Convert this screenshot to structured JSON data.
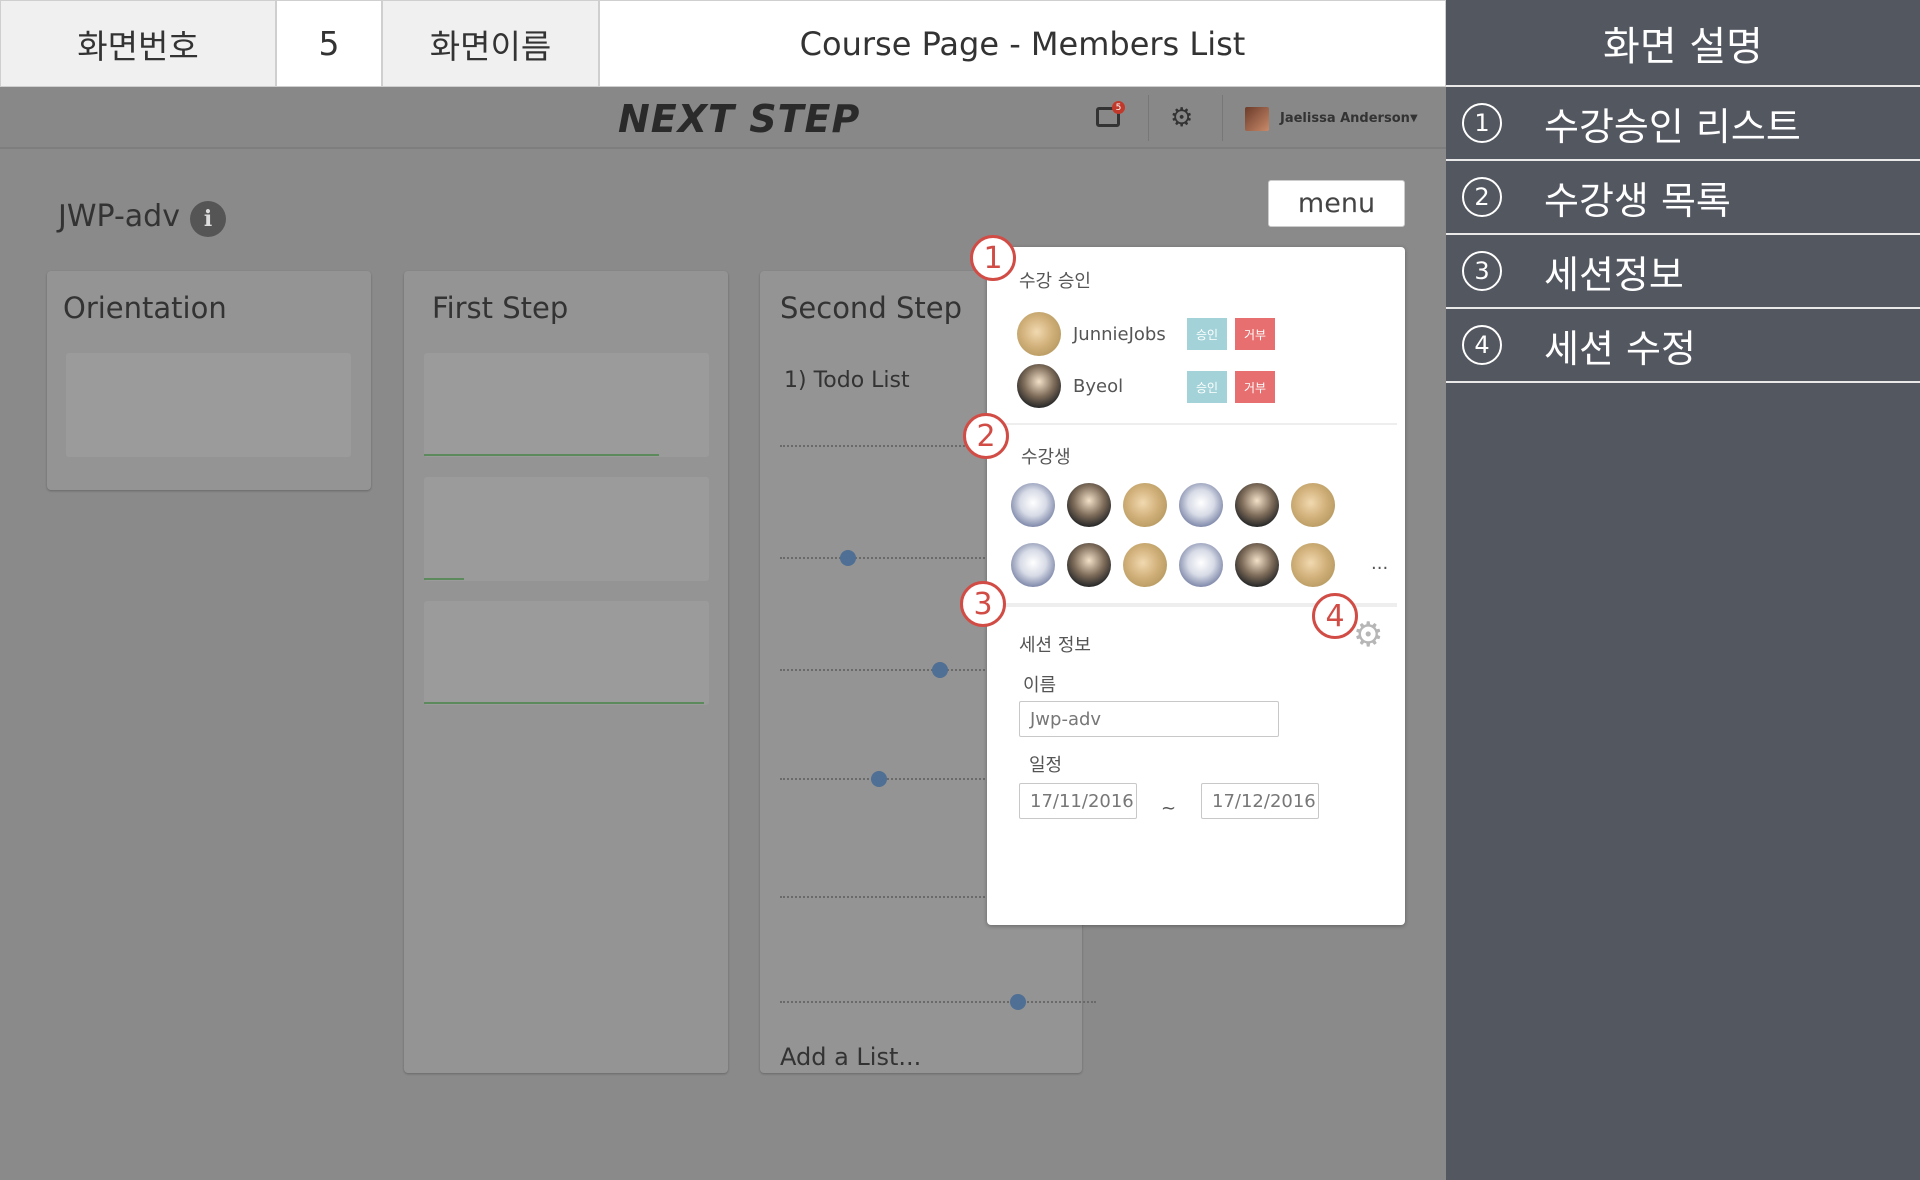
{
  "spec": {
    "screen_no_label": "화면번호",
    "screen_no": "5",
    "screen_name_label": "화면이름",
    "screen_name": "Course Page - Members List"
  },
  "description": {
    "title": "화면 설명",
    "items": [
      {
        "num": "1",
        "text": "수강승인 리스트"
      },
      {
        "num": "2",
        "text": "수강생 목록"
      },
      {
        "num": "3",
        "text": "세션정보"
      },
      {
        "num": "4",
        "text": "세션 수정"
      }
    ]
  },
  "topbar": {
    "logo": "NEXT STEP",
    "notification_count": "5",
    "user_name": "Jaelissa Anderson",
    "icons": [
      "notification-icon",
      "gear-icon",
      "caret-down-icon"
    ]
  },
  "board": {
    "title": "JWP-adv",
    "menu_label": "menu",
    "columns": [
      {
        "title": "Orientation"
      },
      {
        "title": "First Step"
      },
      {
        "title": "Second Step",
        "todo_title": "1) Todo List",
        "add_list": "Add a List..."
      }
    ]
  },
  "popup": {
    "approval_title": "수강 승인",
    "approvals": [
      {
        "name": "JunnieJobs",
        "approve": "승인",
        "reject": "거부"
      },
      {
        "name": "Byeol",
        "approve": "승인",
        "reject": "거부"
      }
    ],
    "members_title": "수강생",
    "members_more": "...",
    "session_title": "세션 정보",
    "name_label": "이름",
    "name_value": "Jwp-adv",
    "schedule_label": "일정",
    "start_date": "17/11/2016",
    "end_date": "17/12/2016",
    "date_separator": "~"
  },
  "markers": [
    "1",
    "2",
    "3",
    "4"
  ],
  "colors": {
    "desc_panel": "#535760",
    "app_overlay": "#8a8a8a",
    "marker_red": "#d24c46",
    "approve": "#a3d3d9",
    "reject": "#e86f6f"
  }
}
